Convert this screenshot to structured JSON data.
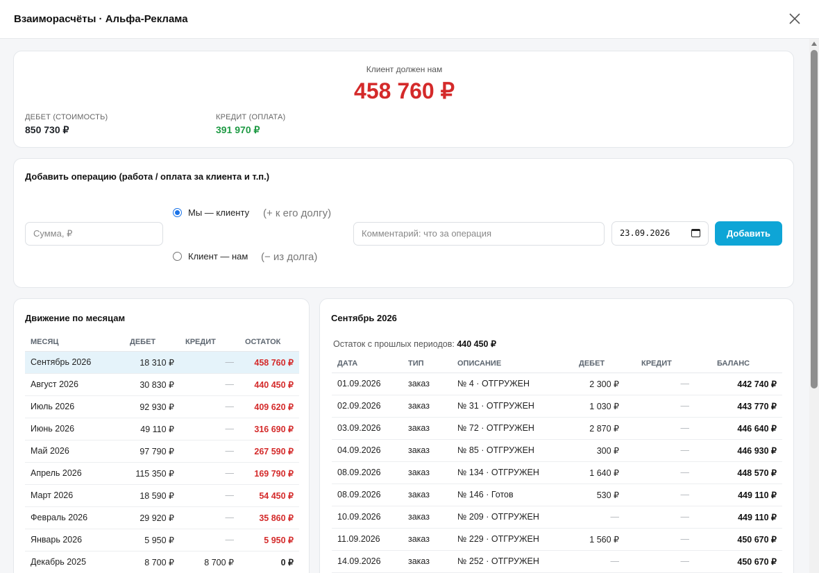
{
  "header": {
    "title": "Взаиморасчёты · Альфа-Реклама"
  },
  "summary": {
    "caption": "Клиент должен нам",
    "total": "458 760 ₽",
    "debit_label": "ДЕБЕТ (СТОИМОСТЬ)",
    "debit_value": "850 730 ₽",
    "credit_label": "КРЕДИТ (ОПЛАТА)",
    "credit_value": "391 970 ₽"
  },
  "add_operation": {
    "title": "Добавить операцию (работа / оплата за клиента и т.п.)",
    "amount_placeholder": "Сумма, ₽",
    "option_us_label": "Мы — клиенту",
    "option_us_hint": "(+ к его долгу)",
    "option_client_label": "Клиент — нам",
    "option_client_hint": "(− из долга)",
    "comment_placeholder": "Комментарий: что за операция",
    "date_value": "23.09.2026",
    "add_button": "Добавить"
  },
  "months": {
    "title": "Движение по месяцам",
    "columns": {
      "month": "МЕСЯЦ",
      "debit": "ДЕБЕТ",
      "credit": "КРЕДИТ",
      "balance": "ОСТАТОК"
    },
    "rows": [
      {
        "month": "Сентябрь 2026",
        "debit": "18 310 ₽",
        "credit": "—",
        "balance": "458 760 ₽"
      },
      {
        "month": "Август 2026",
        "debit": "30 830 ₽",
        "credit": "—",
        "balance": "440 450 ₽"
      },
      {
        "month": "Июль 2026",
        "debit": "92 930 ₽",
        "credit": "—",
        "balance": "409 620 ₽"
      },
      {
        "month": "Июнь 2026",
        "debit": "49 110 ₽",
        "credit": "—",
        "balance": "316 690 ₽"
      },
      {
        "month": "Май 2026",
        "debit": "97 790 ₽",
        "credit": "—",
        "balance": "267 590 ₽"
      },
      {
        "month": "Апрель 2026",
        "debit": "115 350 ₽",
        "credit": "—",
        "balance": "169 790 ₽"
      },
      {
        "month": "Март 2026",
        "debit": "18 590 ₽",
        "credit": "—",
        "balance": "54 450 ₽"
      },
      {
        "month": "Февраль 2026",
        "debit": "29 920 ₽",
        "credit": "—",
        "balance": "35 860 ₽"
      },
      {
        "month": "Январь 2026",
        "debit": "5 950 ₽",
        "credit": "—",
        "balance": "5 950 ₽"
      },
      {
        "month": "Декабрь 2025",
        "debit": "8 700 ₽",
        "credit": "8 700 ₽",
        "balance": "0 ₽"
      }
    ]
  },
  "detail": {
    "title": "Сентябрь 2026",
    "carry_label": "Остаток с прошлых периодов:",
    "carry_value": "440 450 ₽",
    "columns": {
      "date": "ДАТА",
      "type": "ТИП",
      "description": "ОПИСАНИЕ",
      "debit": "ДЕБЕТ",
      "credit": "КРЕДИТ",
      "balance": "БАЛАНС"
    },
    "rows": [
      {
        "date": "01.09.2026",
        "type": "заказ",
        "description": "№ 4 · ОТГРУЖЕН",
        "debit": "2 300 ₽",
        "credit": "—",
        "balance": "442 740 ₽"
      },
      {
        "date": "02.09.2026",
        "type": "заказ",
        "description": "№ 31 · ОТГРУЖЕН",
        "debit": "1 030 ₽",
        "credit": "—",
        "balance": "443 770 ₽"
      },
      {
        "date": "03.09.2026",
        "type": "заказ",
        "description": "№ 72 · ОТГРУЖЕН",
        "debit": "2 870 ₽",
        "credit": "—",
        "balance": "446 640 ₽"
      },
      {
        "date": "04.09.2026",
        "type": "заказ",
        "description": "№ 85 · ОТГРУЖЕН",
        "debit": "300 ₽",
        "credit": "—",
        "balance": "446 930 ₽"
      },
      {
        "date": "08.09.2026",
        "type": "заказ",
        "description": "№ 134 · ОТГРУЖЕН",
        "debit": "1 640 ₽",
        "credit": "—",
        "balance": "448 570 ₽"
      },
      {
        "date": "08.09.2026",
        "type": "заказ",
        "description": "№ 146 · Готов",
        "debit": "530 ₽",
        "credit": "—",
        "balance": "449 110 ₽"
      },
      {
        "date": "10.09.2026",
        "type": "заказ",
        "description": "№ 209 · ОТГРУЖЕН",
        "debit": "—",
        "credit": "—",
        "balance": "449 110 ₽"
      },
      {
        "date": "11.09.2026",
        "type": "заказ",
        "description": "№ 229 · ОТГРУЖЕН",
        "debit": "1 560 ₽",
        "credit": "—",
        "balance": "450 670 ₽"
      },
      {
        "date": "14.09.2026",
        "type": "заказ",
        "description": "№ 252 · ОТГРУЖЕН",
        "debit": "—",
        "credit": "—",
        "balance": "450 670 ₽"
      }
    ]
  },
  "colors": {
    "negative": "#d42a2a",
    "positive": "#1e9a44",
    "accent": "#0ea5d6",
    "selected_row": "#e5f3fa"
  },
  "icons": {
    "close": "close-icon",
    "calendar": "calendar-icon"
  }
}
